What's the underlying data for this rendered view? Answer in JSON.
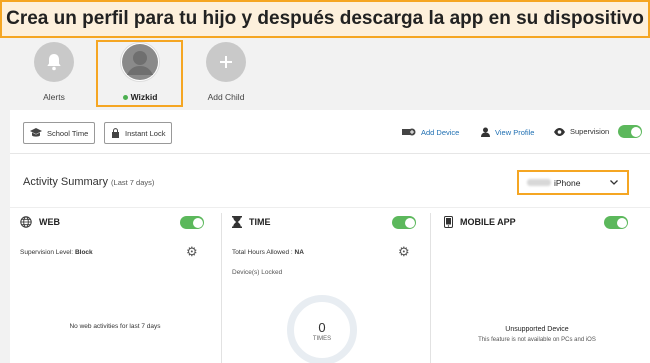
{
  "banner": {
    "text": "Crea un perfil para tu hijo y después descarga la app en su dispositivo"
  },
  "profiles": [
    {
      "label": "Alerts"
    },
    {
      "label": "Wizkid",
      "active": true
    },
    {
      "label": "Add Child"
    }
  ],
  "toolbar": {
    "school_time": "School Time",
    "instant_lock": "Instant Lock",
    "add_device": "Add Device",
    "view_profile": "View Profile",
    "supervision": "Supervision"
  },
  "summary": {
    "title": "Activity Summary",
    "range": "(Last 7 days)",
    "device": "iPhone"
  },
  "web": {
    "title": "WEB",
    "level_label": "Supervision Level:",
    "level_value": "Block",
    "empty": "No web activities for last 7 days"
  },
  "time": {
    "title": "TIME",
    "hours_label": "Total Hours Allowed :",
    "hours_value": "NA",
    "locked": "Device(s) Locked",
    "count": "0",
    "count_label": "TIMES"
  },
  "mobile": {
    "title": "MOBILE APP",
    "unsupported": "Unsupported Device",
    "note": "This feature is not available on PCs and iOS"
  },
  "colors": {
    "accent": "#f5a623",
    "toggle_on": "#5cb85c",
    "link": "#1f6fb2"
  }
}
